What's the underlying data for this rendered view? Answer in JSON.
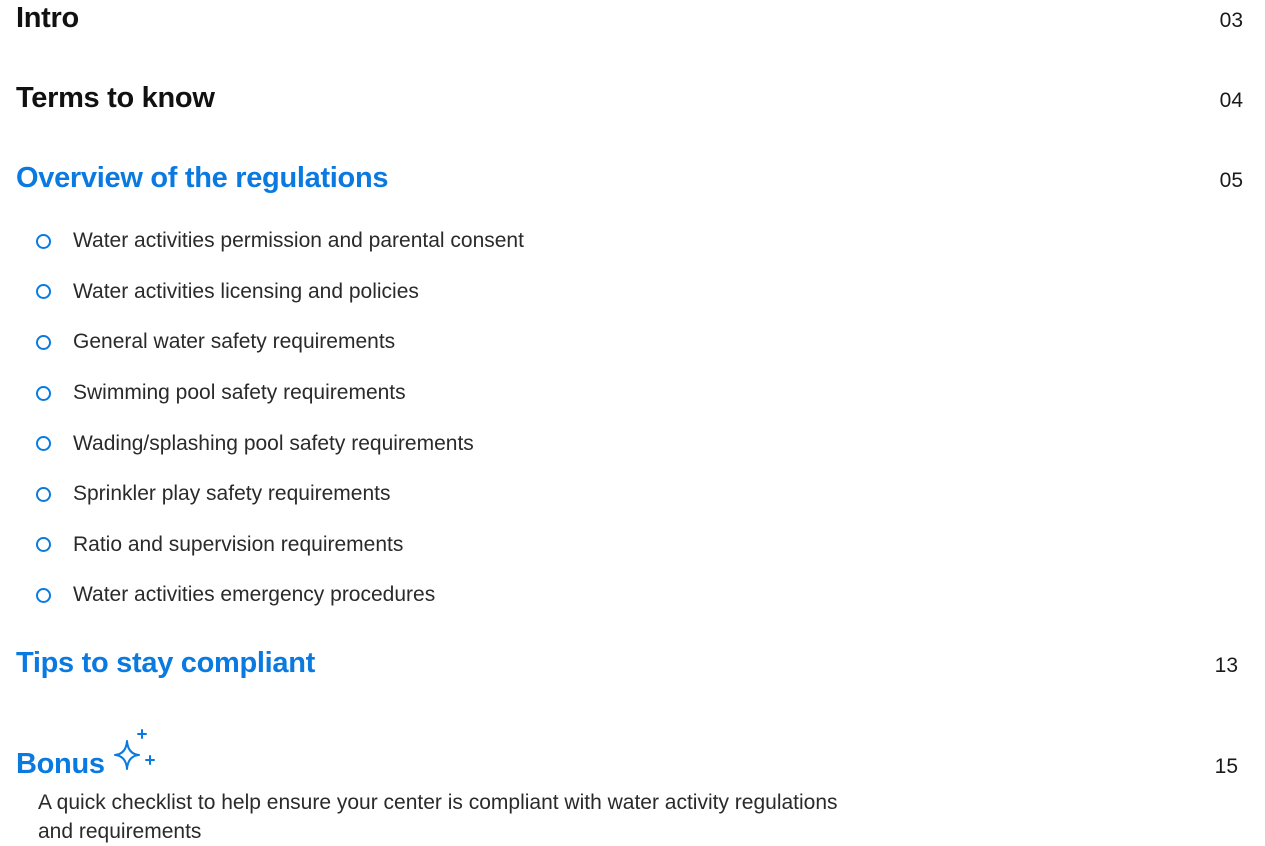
{
  "toc": {
    "intro": {
      "title": "Intro",
      "page": "03"
    },
    "terms": {
      "title": "Terms to know",
      "page": "04"
    },
    "overview": {
      "title": "Overview of the regulations",
      "page": "05",
      "items": [
        "Water activities permission and parental consent",
        "Water activities licensing and policies",
        "General water safety requirements",
        "Swimming pool safety requirements",
        "Wading/splashing pool safety requirements",
        "Sprinkler play safety requirements",
        "Ratio and supervision requirements",
        "Water activities emergency procedures"
      ]
    },
    "tips": {
      "title": "Tips to stay compliant",
      "page": "13"
    },
    "bonus": {
      "title": "Bonus",
      "page": "15",
      "icon": "sparkle-icon",
      "description": "A quick checklist to help ensure your center is compliant with water activity regulations and requirements"
    }
  },
  "colors": {
    "accent": "#0a7ae0",
    "text": "#111111"
  }
}
